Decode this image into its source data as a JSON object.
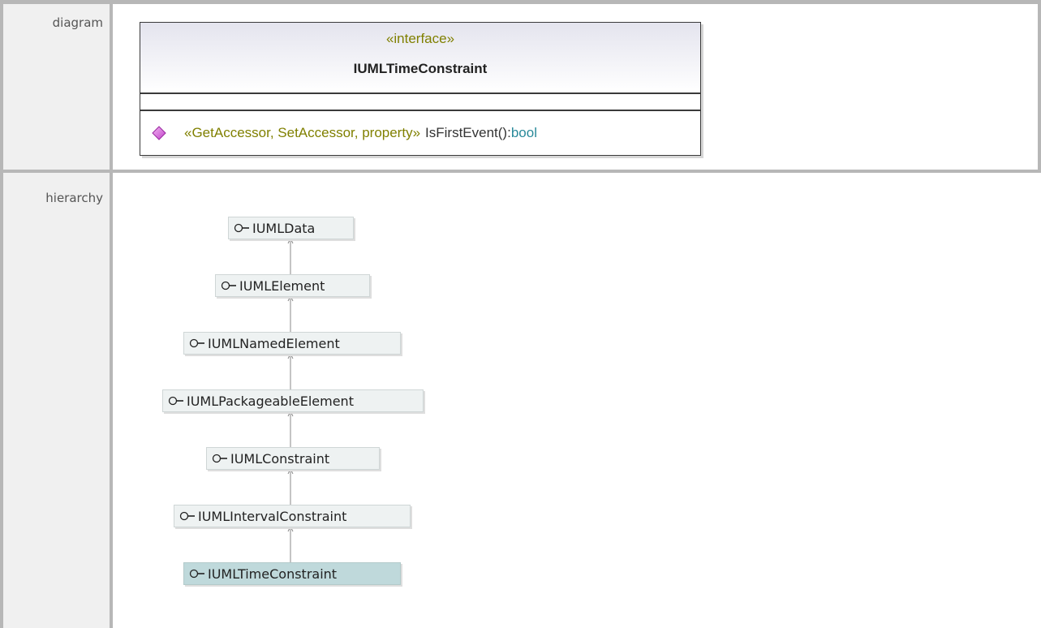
{
  "rows": {
    "diagram_label": "diagram",
    "hierarchy_label": "hierarchy"
  },
  "class_box": {
    "stereotype": "«interface»",
    "name": "IUMLTimeConstraint",
    "operation": {
      "icon": "diamond-icon",
      "stereotype": "«GetAccessor, SetAccessor, property»",
      "name": "IsFirstEvent()",
      "colon": ":",
      "return_type": "bool"
    }
  },
  "hierarchy": [
    {
      "label": "IUMLData",
      "icon": "interface-lollipop-icon",
      "current": false
    },
    {
      "label": "IUMLElement",
      "icon": "interface-lollipop-icon",
      "current": false
    },
    {
      "label": "IUMLNamedElement",
      "icon": "interface-lollipop-icon",
      "current": false
    },
    {
      "label": "IUMLPackageableElement",
      "icon": "interface-lollipop-icon",
      "current": false
    },
    {
      "label": "IUMLConstraint",
      "icon": "interface-lollipop-icon",
      "current": false
    },
    {
      "label": "IUMLIntervalConstraint",
      "icon": "interface-lollipop-icon",
      "current": false
    },
    {
      "label": "IUMLTimeConstraint",
      "icon": "interface-lollipop-icon",
      "current": true
    }
  ],
  "colors": {
    "stereotype": "#808000",
    "type": "#2a8a9a",
    "current_node": "#bfd9db",
    "node": "#eef2f2"
  }
}
